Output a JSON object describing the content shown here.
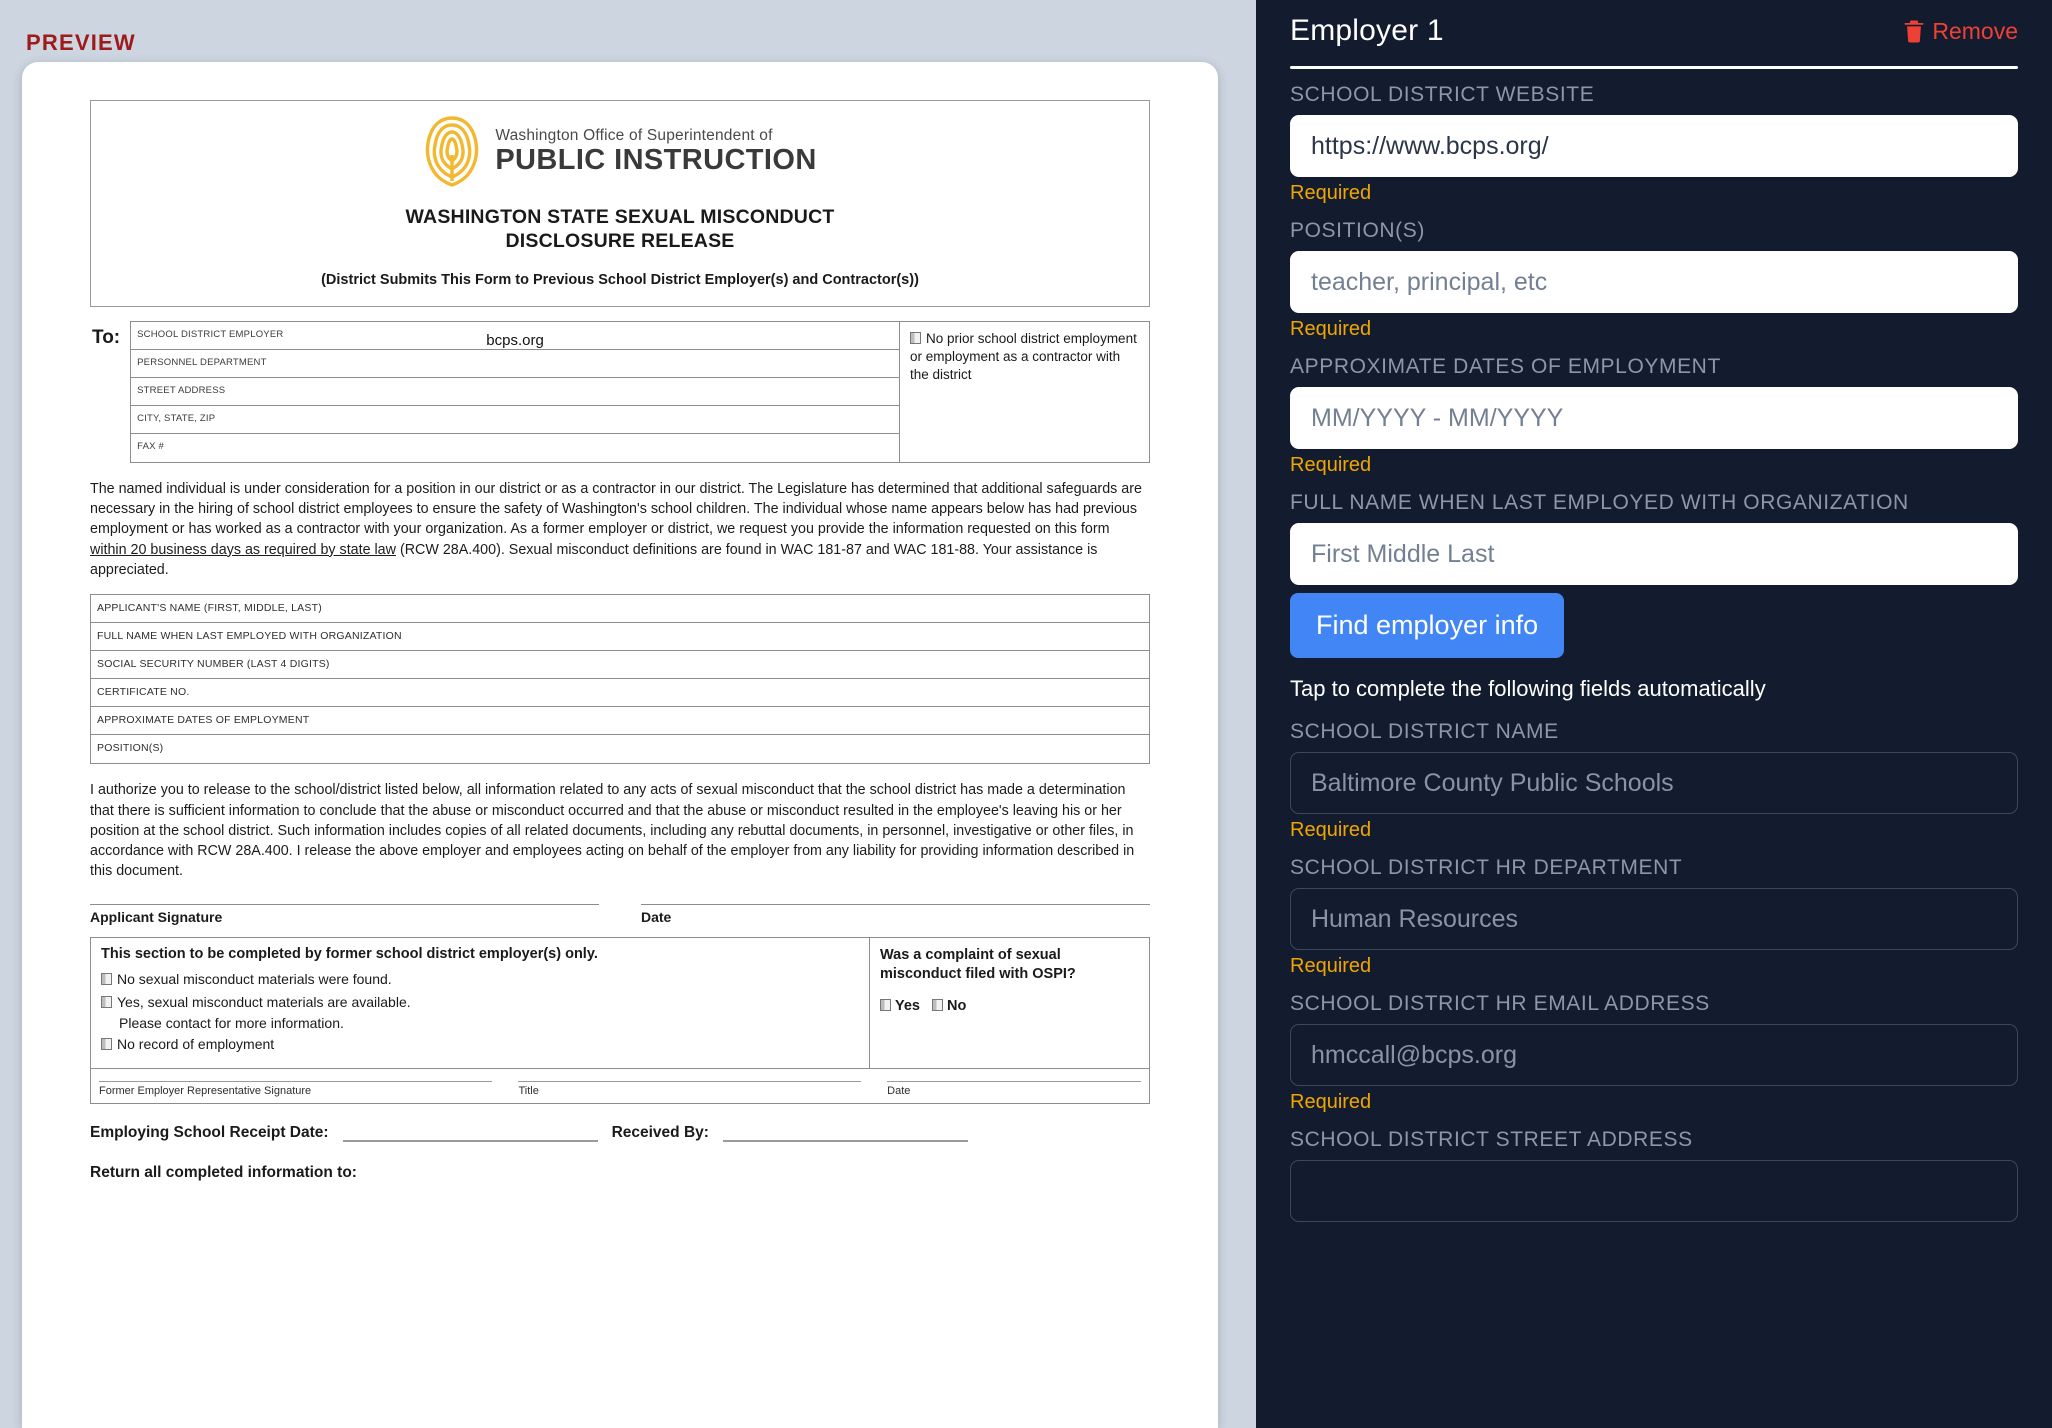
{
  "preview": {
    "label": "PREVIEW",
    "document": {
      "logo_line1": "Washington Office of Superintendent of",
      "logo_line2": "PUBLIC INSTRUCTION",
      "title": "WASHINGTON STATE SEXUAL MISCONDUCT DISCLOSURE RELEASE",
      "title_line1": "WASHINGTON STATE SEXUAL MISCONDUCT",
      "title_line2": "DISCLOSURE RELEASE",
      "subtitle": "(District Submits This Form to Previous School District Employer(s) and Contractor(s))",
      "to_label": "To:",
      "to_rows": [
        {
          "caption": "SCHOOL DISTRICT EMPLOYER",
          "value": "bcps.org"
        },
        {
          "caption": "PERSONNEL DEPARTMENT",
          "value": ""
        },
        {
          "caption": "STREET ADDRESS",
          "value": ""
        },
        {
          "caption": "CITY, STATE, ZIP",
          "value": ""
        },
        {
          "caption": "FAX #",
          "value": ""
        }
      ],
      "no_prior_checkbox_text": "No prior school district employment or employment as a contractor with the district",
      "paragraph1_a": "The named individual is under consideration for a position in our district or as a contractor in our district. The Legislature has determined that additional safeguards are necessary in the hiring of school district employees to ensure the safety of Washington's school children. The individual whose name appears below has had previous employment or has worked as a contractor with your organization. As a former employer or district, we request you provide the information requested on this form ",
      "paragraph1_underlined": "within 20 business days as required by state law",
      "paragraph1_b": " (RCW 28A.400). Sexual misconduct definitions are found in WAC 181-87 and WAC 181-88. Your assistance is appreciated.",
      "applicant_fields": [
        "APPLICANT'S NAME (FIRST, MIDDLE, LAST)",
        "FULL NAME WHEN LAST EMPLOYED WITH ORGANIZATION",
        "SOCIAL SECURITY NUMBER (LAST 4 DIGITS)",
        "CERTIFICATE NO.",
        "APPROXIMATE DATES OF EMPLOYMENT",
        "POSITION(S)"
      ],
      "paragraph2": "I authorize you to release to the school/district listed below, all information related to any acts of sexual misconduct that the school district has made a determination that there is sufficient information to conclude that the abuse or misconduct occurred and that the abuse or misconduct resulted in the employee's leaving his or her position at the school district. Such information includes copies of all related documents, including any rebuttal documents, in personnel, investigative or other files, in accordance with RCW 28A.400.  I release the above employer and employees acting on behalf of the employer from any liability for providing information described in this document.",
      "applicant_signature_caption": "Applicant Signature",
      "date_caption": "Date",
      "former_employer_heading": "This section to be completed by former school district employer(s) only.",
      "former_employer_options": [
        "No sexual misconduct materials were found.",
        "Yes, sexual misconduct materials are available.",
        "No record of employment"
      ],
      "former_employer_sub_option": "Please contact for more information.",
      "ospi_question": "Was a complaint of sexual misconduct filed with OSPI?",
      "ospi_yes": "Yes",
      "ospi_no": "No",
      "rep_signature_caption": "Former Employer Representative Signature",
      "rep_title_caption": "Title",
      "rep_date_caption": "Date",
      "receipt_date_label": "Employing School Receipt Date:",
      "received_by_label": "Received By:",
      "return_label": "Return all completed information to:"
    }
  },
  "form": {
    "title": "Employer 1",
    "remove_label": "Remove",
    "remove_icon": "trash-icon",
    "find_button_label": "Find employer info",
    "hint": "Tap to complete the following fields automatically",
    "accent_color": "#4285f4",
    "required_color": "#f0a500",
    "remove_color": "#ef4036",
    "panel_color": "#131c2e",
    "fields": [
      {
        "label": "SCHOOL DISTRICT WEBSITE",
        "value": "https://www.bcps.org/",
        "placeholder": "",
        "required_text": "Required",
        "readonly": false
      },
      {
        "label": "POSITION(S)",
        "value": "",
        "placeholder": "teacher, principal, etc",
        "required_text": "Required",
        "readonly": false
      },
      {
        "label": "APPROXIMATE DATES OF EMPLOYMENT",
        "value": "",
        "placeholder": "MM/YYYY - MM/YYYY",
        "required_text": "Required",
        "readonly": false
      },
      {
        "label": "FULL NAME WHEN LAST EMPLOYED WITH ORGANIZATION",
        "value": "",
        "placeholder": "First Middle Last",
        "required_text": "",
        "readonly": false
      }
    ],
    "auto_fields": [
      {
        "label": "SCHOOL DISTRICT NAME",
        "value": "",
        "placeholder": "Baltimore County Public Schools",
        "required_text": "Required",
        "readonly": true
      },
      {
        "label": "SCHOOL DISTRICT HR DEPARTMENT",
        "value": "",
        "placeholder": "Human Resources",
        "required_text": "Required",
        "readonly": true
      },
      {
        "label": "SCHOOL DISTRICT HR EMAIL ADDRESS",
        "value": "",
        "placeholder": "hmccall@bcps.org",
        "required_text": "Required",
        "readonly": true
      },
      {
        "label": "SCHOOL DISTRICT STREET ADDRESS",
        "value": "",
        "placeholder": "",
        "required_text": "",
        "readonly": true
      }
    ]
  }
}
